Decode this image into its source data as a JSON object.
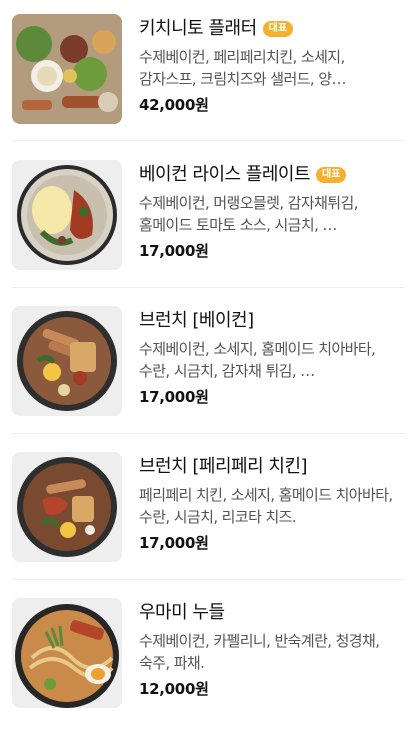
{
  "menu": {
    "items": [
      {
        "name": "키치니토 플래터",
        "badge": "대표",
        "description": "수제베이컨, 페리페리치킨, 소세지, 감자스프, 크림치즈와 샐러드, 양…",
        "price": "42,000원",
        "image_icon": "platter-photo"
      },
      {
        "name": "베이컨 라이스 플레이트",
        "badge": "대표",
        "description": "수제베이컨, 머랭오믈렛, 감자채튀김, 홈메이드 토마토 소스, 시금치, …",
        "price": "17,000원",
        "image_icon": "rice-plate-photo"
      },
      {
        "name": "브런치 [베이컨]",
        "badge": "",
        "description": "수제베이컨, 소세지, 홈메이드 치아바타, 수란, 시금치, 감자채 튀김, …",
        "price": "17,000원",
        "image_icon": "brunch-bacon-photo"
      },
      {
        "name": "브런치 [페리페리 치킨]",
        "badge": "",
        "description": "페리페리 치킨, 소세지, 홈메이드 치아바타, 수란, 시금치, 리코타 치즈.",
        "price": "17,000원",
        "image_icon": "brunch-chicken-photo"
      },
      {
        "name": "우마미 누들",
        "badge": "",
        "description": "수제베이컨, 카펠리니, 반숙계란, 청경채, 숙주, 파채.",
        "price": "12,000원",
        "image_icon": "umami-noodle-photo"
      }
    ]
  }
}
